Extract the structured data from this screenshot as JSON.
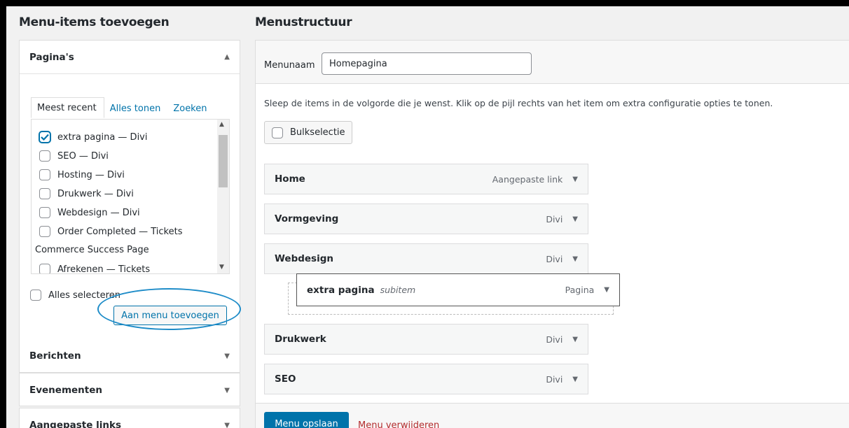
{
  "left_title": "Menu-items toevoegen",
  "right_title": "Menustructuur",
  "pages_section": {
    "title": "Pagina's",
    "tabs": [
      "Meest recent",
      "Alles tonen",
      "Zoeken"
    ],
    "items": [
      {
        "label": "extra pagina — Divi",
        "checked": true
      },
      {
        "label": "SEO — Divi",
        "checked": false
      },
      {
        "label": "Hosting — Divi",
        "checked": false
      },
      {
        "label": "Drukwerk — Divi",
        "checked": false
      },
      {
        "label": "Webdesign — Divi",
        "checked": false
      },
      {
        "label": "Order Completed — Tickets",
        "checked": false
      },
      {
        "label": "Commerce Success Page",
        "checked": null
      },
      {
        "label": "Afrekenen — Tickets",
        "checked": false
      }
    ],
    "select_all": "Alles selecteren",
    "add_button": "Aan menu toevoegen"
  },
  "other_sections": [
    "Berichten",
    "Evenementen",
    "Aangepaste links"
  ],
  "menu_name": {
    "label": "Menunaam",
    "value": "Homepagina"
  },
  "instructions": "Sleep de items in de volgorde die je wenst. Klik op de pijl rechts van het item om extra configuratie opties te tonen.",
  "bulk_select": "Bulkselectie",
  "menu_items": [
    {
      "title": "Home",
      "type": "Aangepaste link"
    },
    {
      "title": "Vormgeving",
      "type": "Divi"
    },
    {
      "title": "Webdesign",
      "type": "Divi"
    },
    {
      "title": "Drukwerk",
      "type": "Divi"
    },
    {
      "title": "SEO",
      "type": "Divi"
    }
  ],
  "sub_item": {
    "title": "extra pagina",
    "tag": "subitem",
    "type": "Pagina"
  },
  "save_button": "Menu opslaan",
  "delete_link": "Menu verwijderen",
  "colors": {
    "accent": "#0073aa",
    "delete": "#b32d2e",
    "highlight": "#1e8cc8"
  }
}
